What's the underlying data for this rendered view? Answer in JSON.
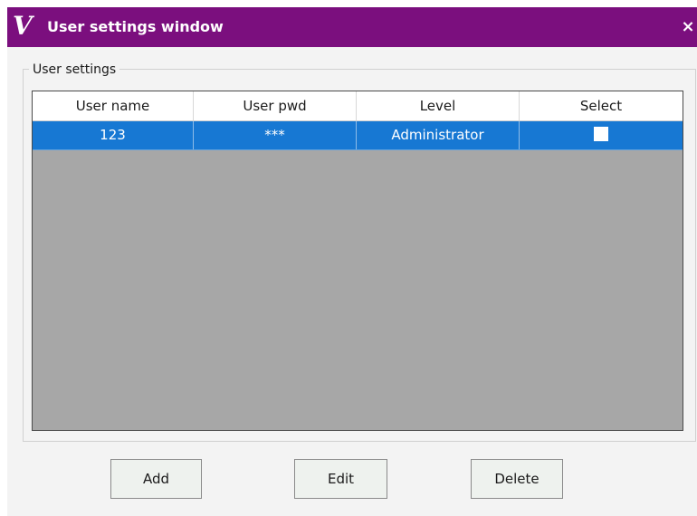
{
  "window": {
    "logo_text": "V",
    "title": "User settings window",
    "close_glyph": "×"
  },
  "group": {
    "label": "User settings"
  },
  "table": {
    "columns": [
      "User name",
      "User pwd",
      "Level",
      "Select"
    ],
    "rows": [
      {
        "user_name": "123",
        "user_pwd": "***",
        "level": "Administrator",
        "select": false
      }
    ]
  },
  "buttons": {
    "add": "Add",
    "edit": "Edit",
    "delete": "Delete"
  },
  "colors": {
    "titlebar": "#7b0f7e",
    "selected_row": "#1778d3",
    "grid_background": "#a7a7a7"
  },
  "icons": {
    "logo": "v-logo-icon",
    "close": "close-icon",
    "checkbox": "checkbox-unchecked-icon"
  }
}
